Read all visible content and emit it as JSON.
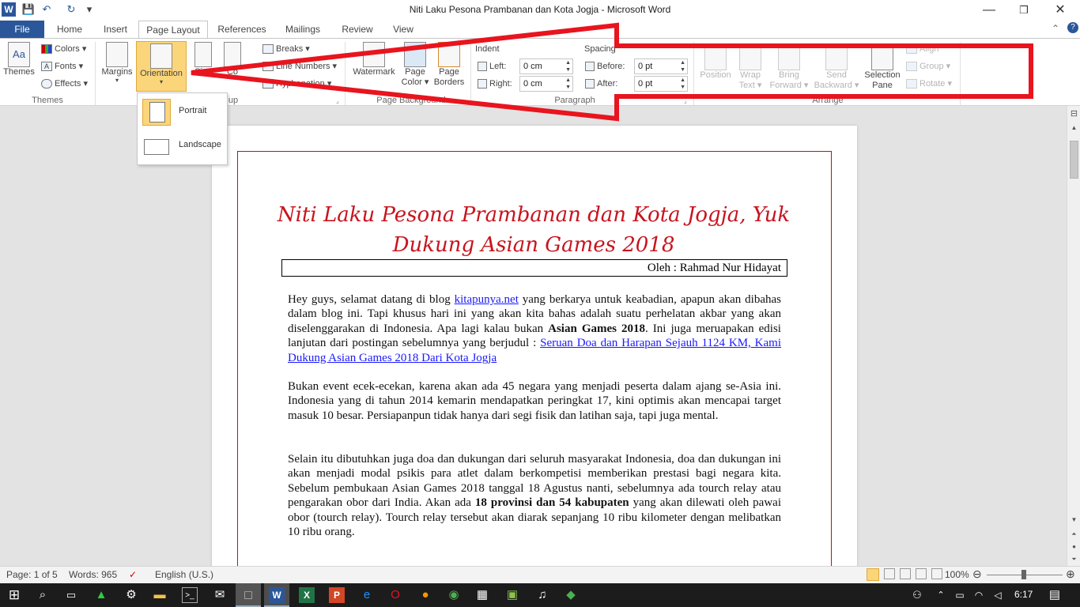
{
  "window": {
    "title": "Niti Laku Pesona Prambanan dan Kota Jogja  -  Microsoft Word",
    "minimize_glyph": "—",
    "restore_glyph": "❐",
    "close_glyph": "✕",
    "help_glyph": "?",
    "collapse_glyph": "⌃"
  },
  "qat": {
    "save": "💾",
    "undo": "↶",
    "redo": "↻",
    "customize": "▾",
    "app_icon_letter": "W"
  },
  "tabs": [
    "File",
    "Home",
    "Insert",
    "Page Layout",
    "References",
    "Mailings",
    "Review",
    "View"
  ],
  "ribbon": {
    "themes": {
      "themes_label": "Themes",
      "colors": "Colors",
      "fonts": "Fonts",
      "effects": "Effects",
      "group_label": "Themes",
      "themes_glyph": "Aa"
    },
    "page_setup": {
      "margins": "Margins",
      "orientation": "Orientation",
      "size": "Size",
      "columns": "Co",
      "breaks": "Breaks",
      "line_numbers": "Line Numbers",
      "hyphenation": "Hyphenation",
      "group_label": "up"
    },
    "page_background": {
      "watermark": "Watermark",
      "page_color_1": "Page",
      "page_color_2": "Color",
      "page_borders_1": "Page",
      "page_borders_2": "Borders",
      "group_label": "Page Background"
    },
    "paragraph": {
      "indent_label": "Indent",
      "left_label": "Left:",
      "left_value": "0 cm",
      "right_label": "Right:",
      "right_value": "0 cm",
      "spacing_label": "Spacing",
      "before_label": "Before:",
      "before_value": "0 pt",
      "after_label": "After:",
      "after_value": "0 pt",
      "group_label": "Paragraph"
    },
    "arrange": {
      "position": "Position",
      "wrap_1": "Wrap",
      "wrap_2": "Text",
      "bring_1": "Bring",
      "bring_2": "Forward",
      "send_1": "Send",
      "send_2": "Backward",
      "selection_1": "Selection",
      "selection_2": "Pane",
      "align": "Align",
      "group": "Group",
      "rotate": "Rotate",
      "group_label": "Arrange"
    }
  },
  "orientation_menu": {
    "portrait": "Portrait",
    "landscape": "Landscape"
  },
  "document": {
    "title_line1": "Niti Laku Pesona Prambanan dan Kota Jogja, Yuk",
    "title_line2": "Dukung Asian Games 2018",
    "author": "Oleh : Rahmad Nur Hidayat",
    "p1_a": "Hey guys, selamat datang di blog ",
    "p1_link": "kitapunya.net",
    "p1_b": " yang berkarya untuk keabadian, apapun akan dibahas dalam blog ini. Tapi khusus hari ini yang akan kita bahas adalah suatu perhelatan akbar yang akan diselenggarakan di Indonesia. Apa lagi kalau bukan ",
    "p1_bold": "Asian Games 2018",
    "p1_c": ". Ini juga meruapakan edisi lanjutan dari postingan sebelumnya yang berjudul : ",
    "p1_link2": "Seruan Doa dan Harapan Sejauh 1124 KM, Kami Dukung Asian Games 2018 Dari Kota Jogja",
    "p2": "Bukan event ecek-ecekan, karena akan ada 45 negara yang menjadi peserta dalam ajang se-Asia ini. Indonesia yang di tahun 2014 kemarin mendapatkan peringkat 17, kini optimis akan mencapai target masuk 10 besar. Persiapanpun tidak hanya dari segi fisik dan latihan saja, tapi juga mental.",
    "p3_a": "Selain itu dibutuhkan juga doa dan dukungan dari seluruh masyarakat Indonesia, doa dan dukungan ini akan menjadi modal psikis para atlet dalam berkompetisi memberikan prestasi bagi negara kita. Sebelum pembukaan Asian Games 2018 tanggal 18 Agustus nanti, sebelumnya ada tourch relay atau pengarakan obor dari India. Akan ada ",
    "p3_bold": "18 provinsi dan 54 kabupaten",
    "p3_b": " yang akan dilewati oleh pawai obor (tourch relay). Tourch relay tersebut akan diarak sepanjang 10 ribu kilometer dengan melibatkan 10 ribu orang."
  },
  "statusbar": {
    "page": "Page: 1 of 5",
    "words": "Words: 965",
    "language": "English (U.S.)",
    "zoom": "100%",
    "zoom_out": "⊖",
    "zoom_in": "⊕"
  },
  "taskbar": {
    "time": "6:17",
    "start_glyph": "⊞",
    "search_glyph": "⌕"
  },
  "colors": {
    "accent": "#2b579a",
    "title_red": "#c8141e",
    "annotation_red": "#e8141e"
  }
}
